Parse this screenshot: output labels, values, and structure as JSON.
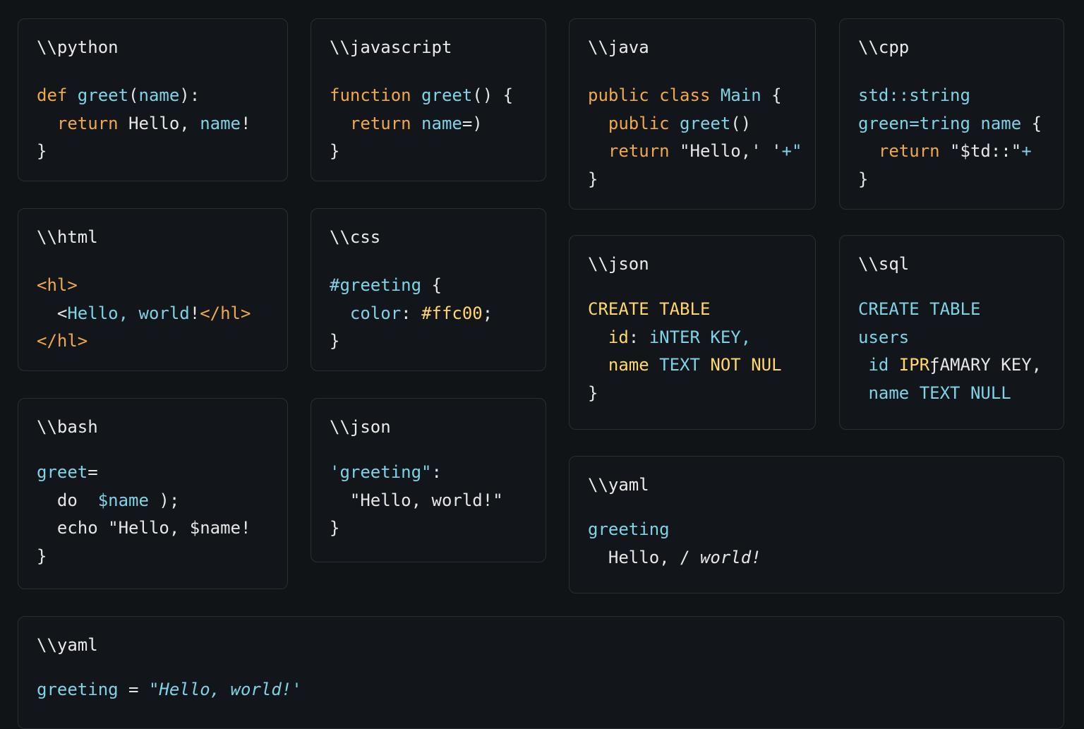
{
  "colors": {
    "background": "#111417",
    "card_border": "#2a2e33",
    "keyword_orange": "#f0a94a",
    "identifier_cyan": "#7fd3e6",
    "plain_text": "#e6e6e6",
    "sql_yellow": "#ffd76a"
  },
  "cards": [
    {
      "lang": "\\\\python",
      "lines": [
        [
          [
            "def ",
            "k"
          ],
          [
            "greet",
            "f"
          ],
          [
            "(",
            "t"
          ],
          [
            "name",
            "f"
          ],
          [
            "):",
            "t"
          ]
        ],
        [
          [
            "  return ",
            "k"
          ],
          [
            "Hello, ",
            "t"
          ],
          [
            "name",
            "f"
          ],
          [
            "!",
            "t"
          ]
        ],
        [
          [
            "}",
            "t"
          ]
        ]
      ]
    },
    {
      "lang": "\\\\javascript",
      "lines": [
        [
          [
            "function ",
            "k"
          ],
          [
            "greet",
            "f"
          ],
          [
            "() {",
            "t"
          ]
        ],
        [
          [
            "  return ",
            "k"
          ],
          [
            "name",
            "f"
          ],
          [
            "=)",
            "t"
          ]
        ],
        [
          [
            "}",
            "t"
          ]
        ]
      ]
    },
    {
      "lang": "\\\\java",
      "lines": [
        [
          [
            "public class ",
            "k"
          ],
          [
            "Main ",
            "f"
          ],
          [
            "{",
            "t"
          ]
        ],
        [
          [
            "  public ",
            "k"
          ],
          [
            "greet",
            "f"
          ],
          [
            "()",
            "t"
          ]
        ],
        [
          [
            "  return ",
            "k"
          ],
          [
            "\"Hello,' '",
            "t"
          ],
          [
            "+\"",
            "f"
          ]
        ],
        [
          [
            "}",
            "t"
          ]
        ]
      ]
    },
    {
      "lang": "\\\\cpp",
      "lines": [
        [
          [
            "std::string",
            "f"
          ]
        ],
        [
          [
            "green=tring name ",
            "f"
          ],
          [
            "{",
            "t"
          ]
        ],
        [
          [
            "  return ",
            "k"
          ],
          [
            "\"$td::\"",
            "t"
          ],
          [
            "+",
            "f"
          ]
        ],
        [
          [
            "}",
            "t"
          ]
        ]
      ]
    },
    {
      "lang": "\\\\html",
      "lines": [
        [
          [
            "<hl>",
            "k"
          ]
        ],
        [
          [
            "  <",
            "t"
          ],
          [
            "Hello, world",
            "f"
          ],
          [
            "!",
            "t"
          ],
          [
            "</hl>",
            "k"
          ]
        ],
        [
          [
            "</hl>",
            "k"
          ]
        ]
      ]
    },
    {
      "lang": "\\\\css",
      "lines": [
        [
          [
            "#greeting ",
            "f"
          ],
          [
            "{",
            "t"
          ]
        ],
        [
          [
            "  color",
            "f"
          ],
          [
            ": ",
            "t"
          ],
          [
            "#ffc00",
            "y"
          ],
          [
            ";",
            "t"
          ]
        ],
        [
          [
            "}",
            "t"
          ]
        ]
      ]
    },
    {
      "lang": "\\\\json",
      "lines": [
        [
          [
            "CREATE TABLE",
            "y"
          ]
        ],
        [
          [
            "  id",
            "y"
          ],
          [
            ": ",
            "t"
          ],
          [
            "iNTER KEY,",
            "f"
          ]
        ],
        [
          [
            "  name ",
            "y"
          ],
          [
            "TEXT ",
            "f"
          ],
          [
            "NOT NUL",
            "y"
          ]
        ],
        [
          [
            "}",
            "t"
          ]
        ]
      ]
    },
    {
      "lang": "\\\\sql",
      "lines": [
        [
          [
            "CREATE TABLE",
            "f"
          ]
        ],
        [
          [
            "users",
            "f"
          ]
        ],
        [
          [
            " id ",
            "f"
          ],
          [
            "IPR",
            "y"
          ],
          [
            "ƒAMARY KEY,",
            "t"
          ]
        ],
        [
          [
            " name ",
            "f"
          ],
          [
            "TEXT NULL",
            "f"
          ]
        ]
      ]
    },
    {
      "lang": "\\\\bash",
      "lines": [
        [
          [
            "greet",
            "f"
          ],
          [
            "=",
            "t"
          ]
        ],
        [
          [
            "  do  ",
            "t"
          ],
          [
            "$name",
            "f"
          ],
          [
            " );",
            "t"
          ]
        ],
        [
          [
            "  echo \"Hello, $name!",
            "t"
          ]
        ],
        [
          [
            "}",
            "t"
          ]
        ]
      ]
    },
    {
      "lang": "\\\\json",
      "lines": [
        [
          [
            "'greeting\"",
            "f"
          ],
          [
            ":",
            "t"
          ]
        ],
        [
          [
            "  \"Hello, world!\"",
            "t"
          ]
        ],
        [
          [
            "}",
            "t"
          ]
        ]
      ]
    },
    {
      "lang": "\\\\yaml",
      "lines": [
        [
          [
            "greeting",
            "f"
          ]
        ],
        [
          [
            "  Hello, ",
            "t"
          ],
          [
            "/ ",
            "t"
          ],
          [
            "world!",
            "ti"
          ]
        ]
      ]
    },
    {
      "lang": "\\\\yaml",
      "lines": [
        [
          [
            "greeting ",
            "f"
          ],
          [
            "= ",
            "t"
          ],
          [
            "\"Hello, world!'",
            "fi"
          ]
        ]
      ]
    }
  ]
}
